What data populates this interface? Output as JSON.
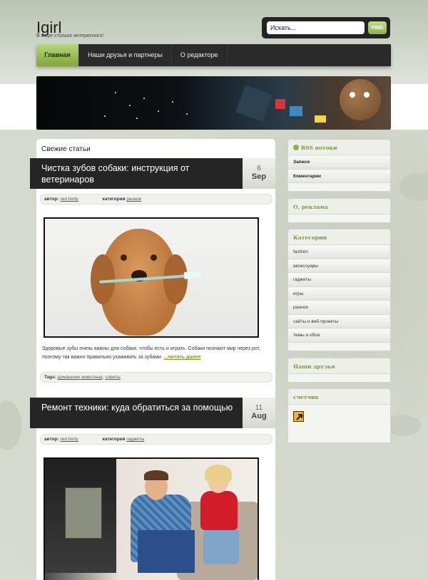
{
  "site": {
    "title": "Igirl",
    "description": "В мире столько интересного!"
  },
  "search": {
    "value": "Искать...",
    "button": "FIND"
  },
  "nav": {
    "items": [
      {
        "label": "Главная"
      },
      {
        "label": "Наши друзья и партнеры"
      },
      {
        "label": "О редакторе"
      }
    ]
  },
  "main": {
    "section_title": "Свежие статьи",
    "posts": [
      {
        "title": "Чистка зубов собаки: инструкция от ветеринаров",
        "day": "6",
        "month": "Sep",
        "author_label": "автор:",
        "author": "red birdy",
        "category_label": "категория",
        "category": "разное",
        "excerpt": "Здоровые зубы очень важны для собаки, чтобы есть и играть. Собаки познают мир через рот, поэтому так важно правильно ухаживать за зубами.",
        "read_more": "...читать далее",
        "tags_label": "Tags:",
        "tag1": "домашние животные",
        "tag_sep": ",",
        "tag2": "советы"
      },
      {
        "title": "Ремонт техники: куда обратиться за помощью",
        "day": "11",
        "month": "Aug",
        "author_label": "автор:",
        "author": "red birdy",
        "category_label": "категория",
        "category": "гаджеты"
      }
    ]
  },
  "sidebar": {
    "rss": {
      "title": "RSS потоки",
      "items": [
        "Записи",
        "Коментарии"
      ]
    },
    "ads": {
      "title": "О, реклама"
    },
    "categories": {
      "title": "Категории",
      "items": [
        "fashion",
        "аксессуары",
        "гаджеты",
        "игры",
        "разное",
        "сайты и веб-проекты",
        "темы и обои"
      ]
    },
    "friends": {
      "title": "Наши друзья"
    },
    "counter": {
      "title": "счетчик"
    }
  },
  "colors": {
    "accent": "#8fb04a",
    "nav_bg": "#2a2a2a",
    "widget_title": "#7b9a3f"
  }
}
